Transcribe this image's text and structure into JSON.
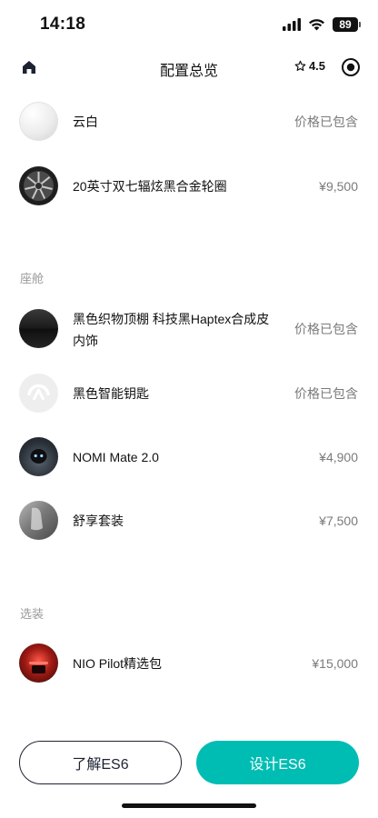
{
  "status_bar": {
    "time": "14:18",
    "battery": "89"
  },
  "nav": {
    "title": "配置总览",
    "rating": "4.5"
  },
  "items_exterior": [
    {
      "name": "云白",
      "price": "价格已包含"
    },
    {
      "name": "20英寸双七辐炫黑合金轮圈",
      "price": "¥9,500"
    }
  ],
  "section_cabin": {
    "label": "座舱"
  },
  "items_cabin": [
    {
      "name_line1": "黑色织物顶棚 科技黑Haptex合成皮",
      "name_line2": "内饰",
      "price": "价格已包含"
    },
    {
      "name": "黑色智能钥匙",
      "price": "价格已包含"
    },
    {
      "name": "NOMI Mate 2.0",
      "price": "¥4,900"
    },
    {
      "name": "舒享套装",
      "price": "¥7,500"
    }
  ],
  "section_options": {
    "label": "选装"
  },
  "items_options": [
    {
      "name": "NIO Pilot精选包",
      "price": "¥15,000"
    }
  ],
  "buttons": {
    "learn": "了解ES6",
    "design": "设计ES6"
  },
  "colors": {
    "accent": "#00bdb4",
    "dark": "#1d2233"
  }
}
